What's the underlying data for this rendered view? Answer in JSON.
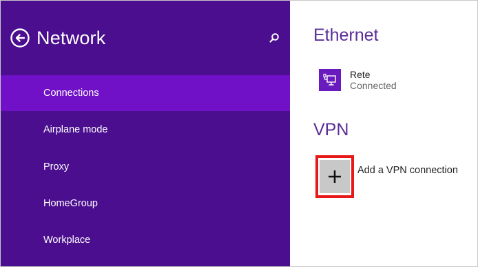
{
  "window": {
    "accent": "#7010c7",
    "sidebar_bg": "#4a0e8f",
    "content_bg": "#ffffff"
  },
  "sidebar": {
    "title": "Network",
    "back_icon": "back-arrow-circle-icon",
    "search_icon": "search-icon",
    "items": [
      {
        "label": "Connections",
        "selected": true
      },
      {
        "label": "Airplane mode",
        "selected": false
      },
      {
        "label": "Proxy",
        "selected": false
      },
      {
        "label": "HomeGroup",
        "selected": false
      },
      {
        "label": "Workplace",
        "selected": false
      }
    ]
  },
  "content": {
    "ethernet": {
      "title": "Ethernet",
      "connection": {
        "name": "Rete",
        "status": "Connected",
        "icon": "ethernet-network-icon"
      }
    },
    "vpn": {
      "title": "VPN",
      "add_label": "Add a VPN connection",
      "add_icon": "plus-icon",
      "highlight_color": "#e81818"
    }
  }
}
